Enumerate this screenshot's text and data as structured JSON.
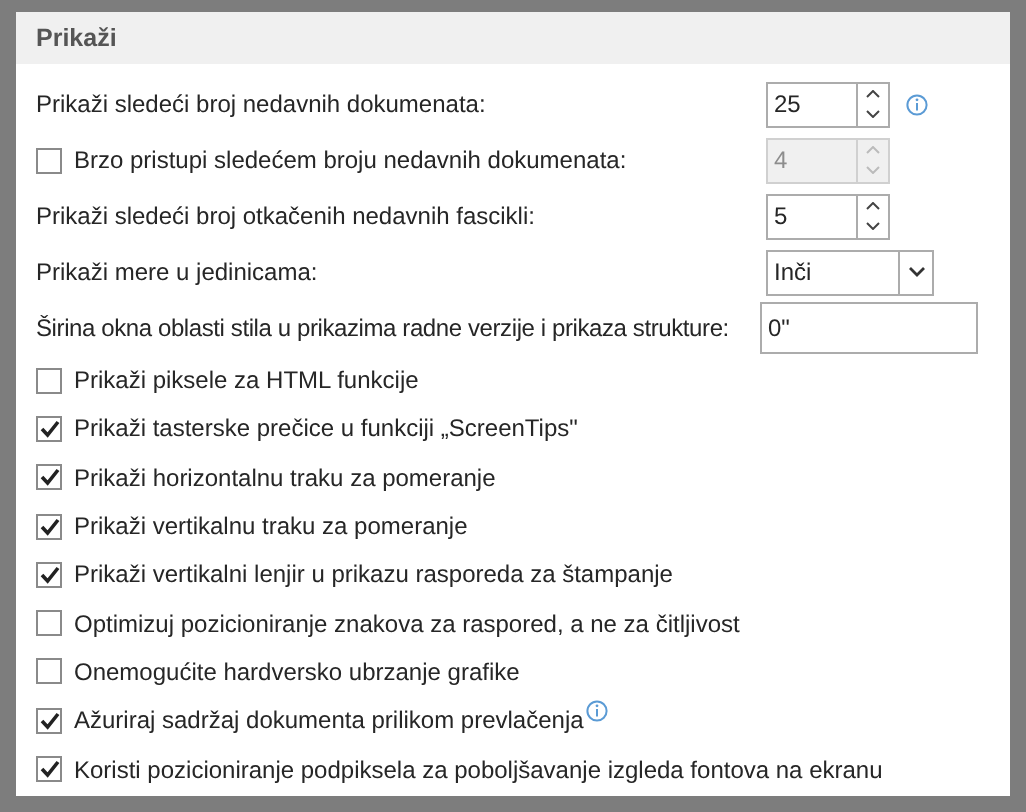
{
  "section": {
    "title": "Prikaži"
  },
  "rows": [
    {
      "kind": "spinner",
      "label": "Prikaži sledeći broj nedavnih dokumenata:",
      "value": "25",
      "disabled": false,
      "info": true
    },
    {
      "kind": "checkbox-spinner",
      "label": "Brzo pristupi sledećem broju nedavnih dokumenata:",
      "checked": false,
      "value": "4",
      "disabled": true
    },
    {
      "kind": "spinner",
      "label": "Prikaži sledeći broj otkačenih nedavnih fascikli:",
      "value": "5",
      "disabled": false
    },
    {
      "kind": "dropdown",
      "label": "Prikaži mere u jedinicama:",
      "value": "Inči"
    },
    {
      "kind": "text",
      "label": "Širina okna oblasti stila u prikazima radne verzije i prikaza strukture:",
      "value": "0\""
    },
    {
      "kind": "checkbox",
      "label": "Prikaži piksele za HTML funkcije",
      "checked": false
    },
    {
      "kind": "checkbox",
      "label": "Prikaži tasterske prečice u funkciji „ScreenTips\"",
      "checked": true
    },
    {
      "kind": "checkbox",
      "label": "Prikaži horizontalnu traku za pomeranje",
      "checked": true
    },
    {
      "kind": "checkbox",
      "label": "Prikaži vertikalnu traku za pomeranje",
      "checked": true
    },
    {
      "kind": "checkbox",
      "label": "Prikaži vertikalni lenjir u prikazu rasporeda za štampanje",
      "checked": true
    },
    {
      "kind": "checkbox",
      "label": "Optimizuj pozicioniranje znakova za raspored, a ne za čitljivost",
      "checked": false
    },
    {
      "kind": "checkbox",
      "label": "Onemogućite hardversko ubrzanje grafike",
      "checked": false
    },
    {
      "kind": "checkbox",
      "label": "Ažuriraj sadržaj dokumenta prilikom prevlačenja",
      "checked": true,
      "info": true
    },
    {
      "kind": "checkbox",
      "label": "Koristi pozicioniranje podpiksela za poboljšavanje izgleda fontova na ekranu",
      "checked": true
    }
  ]
}
